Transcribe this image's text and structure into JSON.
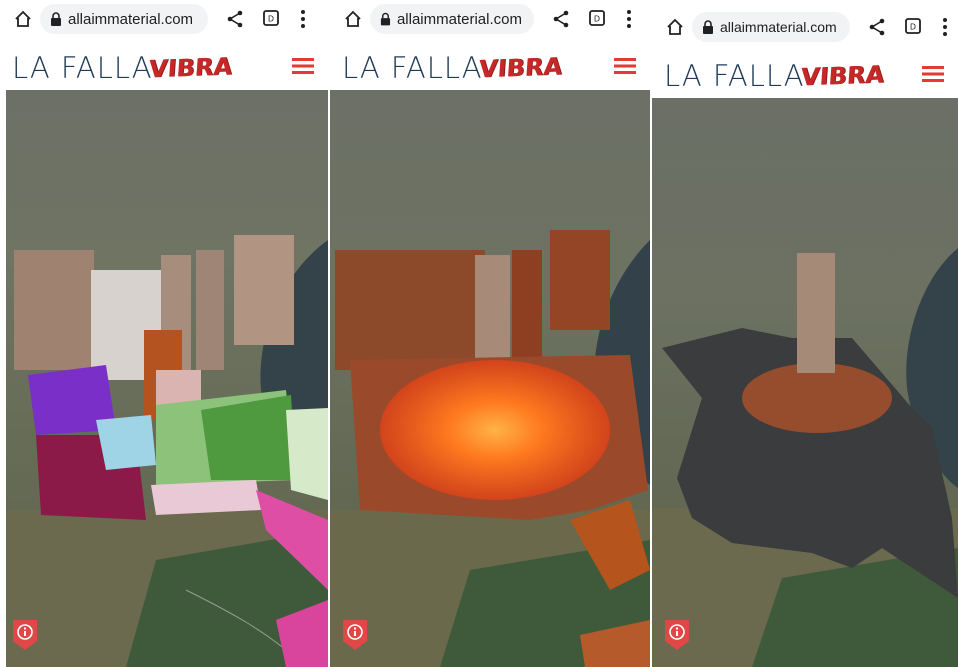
{
  "browser": {
    "url": "allaimmaterial.com",
    "icons": [
      "home-icon",
      "lock-icon",
      "share-icon",
      "tabs-icon",
      "more-icon"
    ]
  },
  "site": {
    "logo_main": "LA FALLA",
    "logo_accent": "VIBRA",
    "logo_color": "#1f3a57",
    "accent_color": "#c62828",
    "menu_icon": "hamburger-menu-icon",
    "info_icon": "info-icon"
  },
  "panels": [
    {
      "scene": "colored-blocks"
    },
    {
      "scene": "burning"
    },
    {
      "scene": "ashes"
    }
  ]
}
